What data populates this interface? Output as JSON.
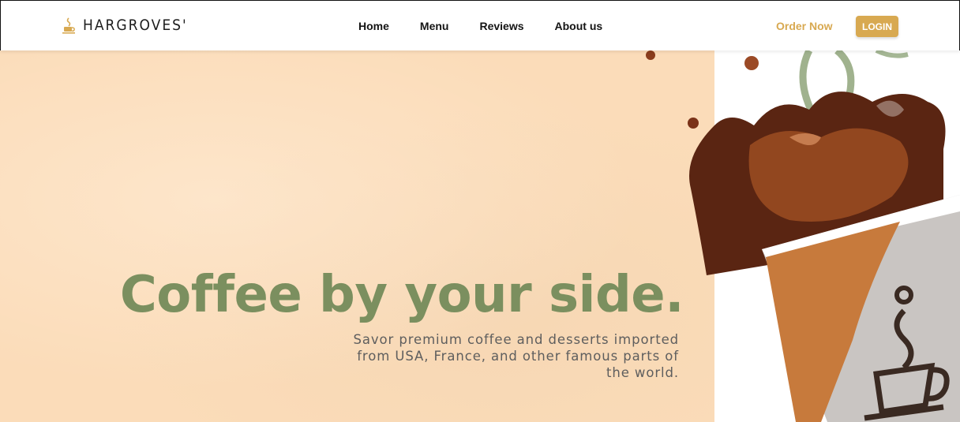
{
  "brand": {
    "name": "HARGROVES'",
    "logo_icon": "coffee-cup-icon"
  },
  "nav": {
    "items": [
      "Home",
      "Menu",
      "Reviews",
      "About us"
    ]
  },
  "actions": {
    "order_label": "Order Now",
    "login_label": "LOGIN"
  },
  "hero": {
    "title": "Coffee by your side.",
    "subtitle": "Savor premium coffee and desserts imported from USA, France, and other famous parts of the world."
  },
  "colors": {
    "accent": "#d8a951",
    "title_green": "#7b8f5f",
    "hero_bg": "#fbdcb9",
    "subtitle_gray": "#5e5e5e"
  }
}
